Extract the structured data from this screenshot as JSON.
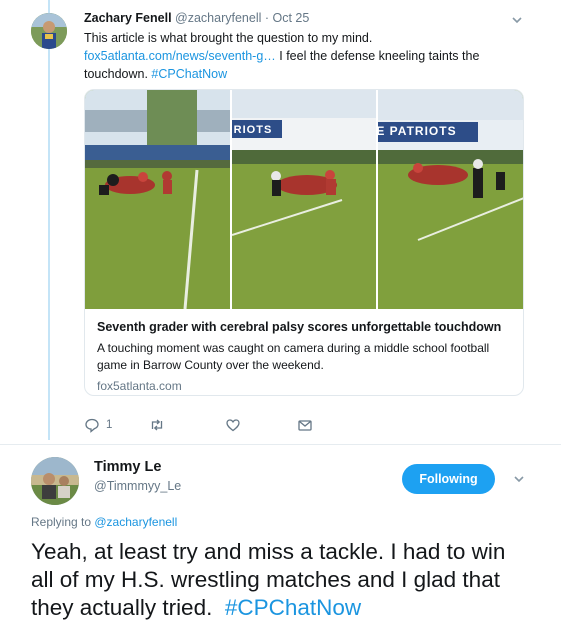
{
  "reply_tweet": {
    "author_name": "Zachary Fenell",
    "author_handle": "@zacharyfenell",
    "separator": "·",
    "timestamp": "Oct 25",
    "text_line1": "This article is what brought the question to my mind.",
    "link_text": "fox5atlanta.com/news/seventh-g…",
    "text_after_link": " I feel the defense kneeling taints the",
    "text_line3": "touchdown. ",
    "hashtag": "#CPChatNow",
    "card": {
      "title": "Seventh grader with cerebral palsy scores unforgettable touchdown",
      "description": "A touching moment was caught on camera during a middle school football game in Barrow County over the weekend.",
      "domain": "fox5atlanta.com",
      "banner_text_1": "RIOTS",
      "banner_text_2": "E PATRIOTS"
    },
    "actions": {
      "reply_count": "1",
      "retweet_count": "",
      "like_count": ""
    }
  },
  "main_tweet": {
    "author_name": "Timmy Le",
    "author_handle": "@Timmmyy_Le",
    "follow_label": "Following",
    "replying_prefix": "Replying to ",
    "replying_to": "@zacharyfenell",
    "text": "Yeah, at least try and miss a tackle. I had to win all of my H.S. wrestling matches and I glad that they actually tried.  ",
    "hashtag": "#CPChatNow"
  },
  "icons": {
    "reply": "reply-icon",
    "retweet": "retweet-icon",
    "like": "heart-icon",
    "message": "envelope-icon",
    "more": "chevron-down-icon"
  },
  "colors": {
    "link": "#1b95e0",
    "follow_button": "#1da1f2",
    "secondary_text": "#657786",
    "thread_line": "#c4e4f7"
  }
}
